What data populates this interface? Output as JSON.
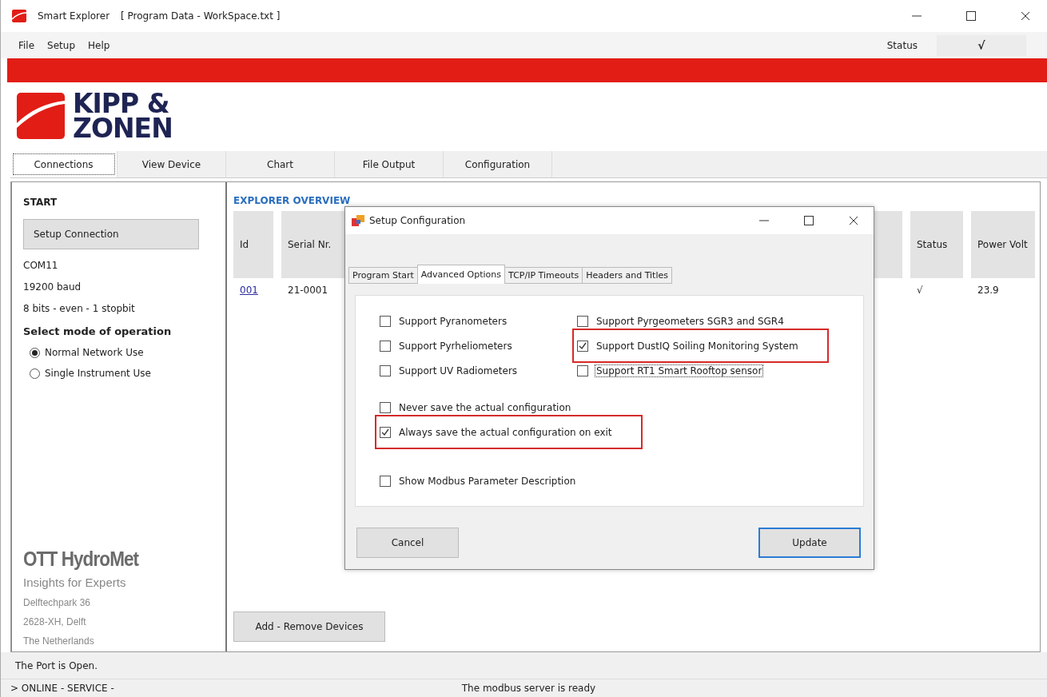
{
  "window": {
    "title": "Smart Explorer",
    "document": "[ Program Data - WorkSpace.txt ]"
  },
  "menu": [
    "File",
    "Setup",
    "Help"
  ],
  "status_indicator": {
    "label": "Status",
    "value": "√"
  },
  "logo": {
    "lines": [
      "KIPP &",
      "ZONEN"
    ]
  },
  "tabs": [
    {
      "label": "Connections",
      "selected": true
    },
    {
      "label": "View Device",
      "selected": false
    },
    {
      "label": "Chart",
      "selected": false
    },
    {
      "label": "File Output",
      "selected": false
    },
    {
      "label": "Configuration",
      "selected": false
    }
  ],
  "start_panel": {
    "title": "START",
    "setup_button": "Setup Connection",
    "port_info": [
      "COM11",
      "19200 baud",
      "8 bits - even - 1 stopbit"
    ],
    "mode_title": "Select mode of operation",
    "modes": [
      {
        "label": "Normal Network Use",
        "selected": true
      },
      {
        "label": "Single Instrument Use",
        "selected": false
      }
    ],
    "company": {
      "name": "OTT HydroMet",
      "tagline": "Insights for Experts",
      "address": [
        "Delftechpark 36",
        "2628-XH, Delft",
        "The Netherlands"
      ]
    }
  },
  "overview": {
    "title": "EXPLORER OVERVIEW",
    "columns": [
      "Id",
      "Serial Nr.",
      "Status",
      "Power Volt"
    ],
    "rows": [
      {
        "id": "001",
        "serial": "21-0001",
        "status": "√",
        "power": "23.9"
      }
    ],
    "add_button": "Add - Remove Devices"
  },
  "dialog": {
    "title": "Setup Configuration",
    "tabs": [
      {
        "label": "Program Start",
        "selected": false
      },
      {
        "label": "Advanced Options",
        "selected": true
      },
      {
        "label": "TCP/IP Timeouts",
        "selected": false
      },
      {
        "label": "Headers and Titles",
        "selected": false
      }
    ],
    "support_left": [
      {
        "label": "Support Pyranometers",
        "checked": false,
        "highlighted": false,
        "focused": false
      },
      {
        "label": "Support Pyrheliometers",
        "checked": false,
        "highlighted": false,
        "focused": false
      },
      {
        "label": "Support UV Radiometers",
        "checked": false,
        "highlighted": false,
        "focused": false
      }
    ],
    "support_right": [
      {
        "label": "Support Pyrgeometers SGR3 and SGR4",
        "checked": false,
        "highlighted": false,
        "focused": false
      },
      {
        "label": "Support DustIQ Soiling Monitoring System",
        "checked": true,
        "highlighted": true,
        "focused": false
      },
      {
        "label": "Support RT1 Smart Rooftop sensor",
        "checked": false,
        "highlighted": false,
        "focused": true
      }
    ],
    "save_options": [
      {
        "label": "Never save the actual configuration",
        "checked": false,
        "highlighted": false,
        "focused": false
      },
      {
        "label": "Always save the actual configuration on exit",
        "checked": true,
        "highlighted": true,
        "focused": false
      }
    ],
    "extra_options": [
      {
        "label": "Show Modbus Parameter Description",
        "checked": false,
        "highlighted": false,
        "focused": false
      }
    ],
    "buttons": [
      {
        "label": "Cancel",
        "default": false
      },
      {
        "label": "Update",
        "default": true
      }
    ]
  },
  "status_message": "The Port is Open.",
  "status_bar": {
    "mode": "> ONLINE  - SERVICE -",
    "message": "The modbus server is ready"
  }
}
